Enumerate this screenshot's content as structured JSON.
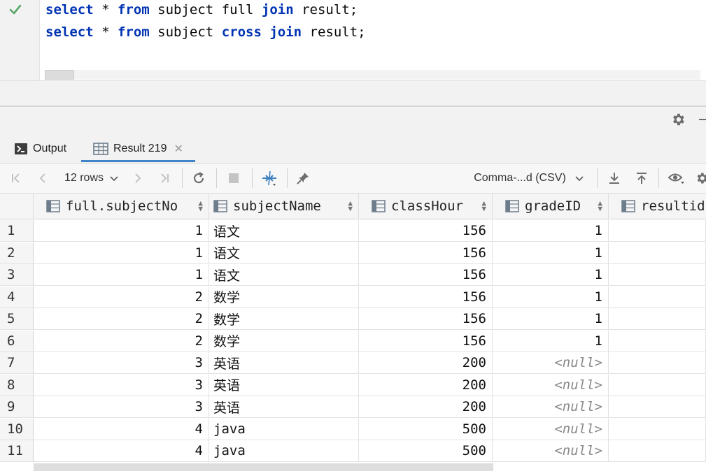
{
  "editor": {
    "lines": [
      {
        "kw1": "select",
        "mid1": " * ",
        "kw2": "from",
        "mid2": " subject full ",
        "kw3": "join",
        "tail": " result;"
      },
      {
        "kw1": "select",
        "mid1": " * ",
        "kw2": "from",
        "mid2": " subject ",
        "kw3": "cross join",
        "tail": " result;"
      }
    ]
  },
  "tabs": {
    "output_label": "Output",
    "result_label": "Result 219"
  },
  "toolbar": {
    "rows_label": "12 rows",
    "format_label": "Comma-...d (CSV)"
  },
  "grid": {
    "columns": [
      "full.subjectNo",
      "subjectName",
      "classHour",
      "gradeID",
      "resultid"
    ],
    "rows": [
      {
        "n": "1",
        "no": "1",
        "name": "语文",
        "hour": "156",
        "grade": "1"
      },
      {
        "n": "2",
        "no": "1",
        "name": "语文",
        "hour": "156",
        "grade": "1"
      },
      {
        "n": "3",
        "no": "1",
        "name": "语文",
        "hour": "156",
        "grade": "1"
      },
      {
        "n": "4",
        "no": "2",
        "name": "数学",
        "hour": "156",
        "grade": "1"
      },
      {
        "n": "5",
        "no": "2",
        "name": "数学",
        "hour": "156",
        "grade": "1"
      },
      {
        "n": "6",
        "no": "2",
        "name": "数学",
        "hour": "156",
        "grade": "1"
      },
      {
        "n": "7",
        "no": "3",
        "name": "英语",
        "hour": "200",
        "grade": "<null>"
      },
      {
        "n": "8",
        "no": "3",
        "name": "英语",
        "hour": "200",
        "grade": "<null>"
      },
      {
        "n": "9",
        "no": "3",
        "name": "英语",
        "hour": "200",
        "grade": "<null>"
      },
      {
        "n": "10",
        "no": "4",
        "name": "java",
        "hour": "500",
        "grade": "<null>"
      },
      {
        "n": "11",
        "no": "4",
        "name": "java",
        "hour": "500",
        "grade": "<null>"
      }
    ]
  },
  "colors": {
    "keyword": "#0033b3",
    "accent": "#4083c9",
    "check": "#59a869"
  },
  "icons": [
    "check-icon",
    "settings-icon",
    "output-console-icon",
    "table-icon",
    "first-page-icon",
    "prev-page-icon",
    "next-page-icon",
    "last-page-icon",
    "refresh-icon",
    "stop-icon",
    "compare-icon",
    "pin-icon",
    "download-icon",
    "upload-icon",
    "view-icon"
  ]
}
